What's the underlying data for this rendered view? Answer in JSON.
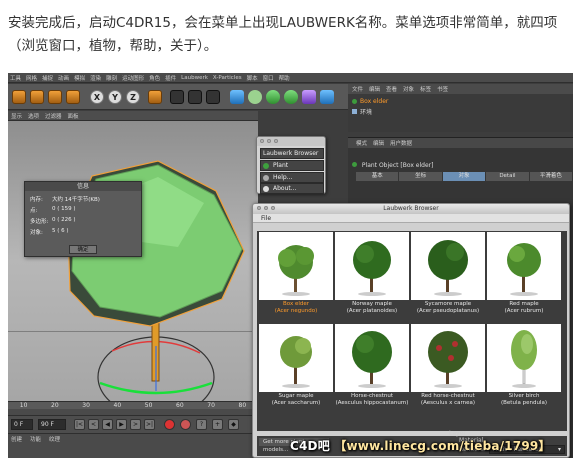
{
  "caption": {
    "line1": "安装完成后，启动C4DR15，会在菜单上出现LAUBWERK名称。菜单选项非常简单，就四项",
    "line2": "（浏览窗口，植物，帮助，关于）。"
  },
  "c4d": {
    "menubar": [
      "工具",
      "网格",
      "捕捉",
      "动画",
      "模拟",
      "渲染",
      "雕刻",
      "运动图形",
      "角色",
      "插件",
      "Laubwerk",
      "X-Particles",
      "脚本",
      "窗口",
      "帮助"
    ],
    "viewport_menu": [
      "显示",
      "选项",
      "过滤器",
      "面板"
    ],
    "object_manager": {
      "tabs": [
        "文件",
        "编辑",
        "查看",
        "对象",
        "标签",
        "书签"
      ],
      "objects": [
        "Box elder",
        "环境"
      ]
    },
    "attributes": {
      "tabs_top": [
        "模式",
        "编辑",
        "用户数据"
      ],
      "object_name": "Plant Object [Box elder]",
      "tabs": [
        "基本",
        "坐标",
        "对象",
        "Detail",
        "平滑着色"
      ]
    },
    "timeline": {
      "ticks": [
        "10",
        "20",
        "30",
        "40",
        "50",
        "60",
        "70",
        "80"
      ],
      "frame_left": "0 F",
      "frame_right": "90 F"
    },
    "material": {
      "tabs": [
        "创建",
        "功能",
        "纹理"
      ]
    }
  },
  "laubwerk_menu": {
    "items": [
      "Laubwerk Browser",
      "Plant",
      "Help...",
      "About..."
    ]
  },
  "info_dialog": {
    "title": "信息",
    "rows": [
      {
        "k": "内存:",
        "v": "大约 14千字节(KB)"
      },
      {
        "k": "点:",
        "v": "0 ( 159 )"
      },
      {
        "k": "多边形:",
        "v": "0 ( 226 )"
      },
      {
        "k": "对象:",
        "v": "5 ( 6 )"
      }
    ],
    "ok": "确定"
  },
  "browser": {
    "title": "Laubwerk Browser",
    "menu": "File",
    "plants": [
      {
        "name": "Box elder",
        "latin": "(Acer negundo)",
        "selected": true
      },
      {
        "name": "Norway maple",
        "latin": "(Acer platanoides)",
        "selected": false
      },
      {
        "name": "Sycamore maple",
        "latin": "(Acer pseudoplatanus)",
        "selected": false
      },
      {
        "name": "Red maple",
        "latin": "(Acer rubrum)",
        "selected": false
      },
      {
        "name": "Sugar maple",
        "latin": "(Acer saccharum)",
        "selected": false
      },
      {
        "name": "Horse-chestnut",
        "latin": "(Aesculus hippocastanum)",
        "selected": false
      },
      {
        "name": "Red horse-chestnut",
        "latin": "(Aesculus x carnea)",
        "selected": false
      },
      {
        "name": "Silver birch",
        "latin": "(Betula pendula)",
        "selected": false
      }
    ],
    "get_more": "Get more plant models...",
    "material_label": "Material",
    "renderer_label": "Renderer",
    "renderer_value": "Active Renderer",
    "layer_label": "Layer"
  },
  "watermark": {
    "a": "C4D吧",
    "b": "【www.linecg.com/tieba/1799】"
  },
  "colors": {
    "selected_text": "#ff9b2a",
    "attr_tab_active": "#6b8fb5",
    "tree_green": "#7ccc72"
  }
}
